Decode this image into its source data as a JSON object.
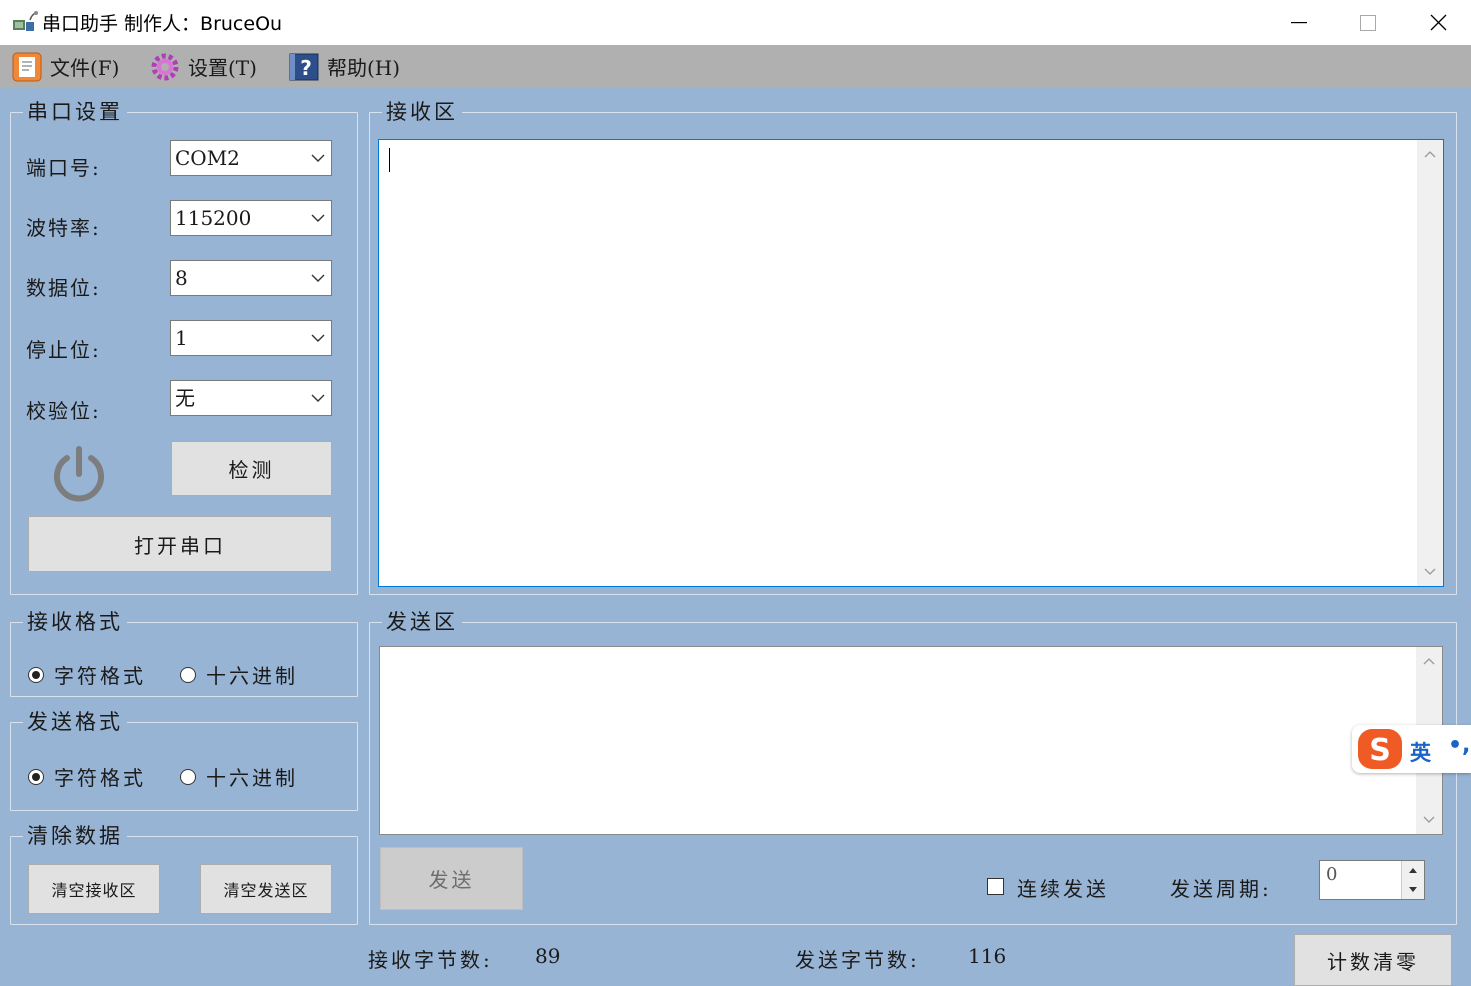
{
  "window": {
    "title": "串口助手 制作人：BruceOu"
  },
  "menu": {
    "file": "文件(F)",
    "settings": "设置(T)",
    "help": "帮助(H)"
  },
  "serial_settings": {
    "group_title": "串口设置",
    "port_label": "端口号:",
    "port_value": "COM2",
    "baud_label": "波特率:",
    "baud_value": "115200",
    "data_bits_label": "数据位:",
    "data_bits_value": "8",
    "stop_bits_label": "停止位:",
    "stop_bits_value": "1",
    "parity_label": "校验位:",
    "parity_value": "无",
    "detect_button": "检测",
    "open_button": "打开串口"
  },
  "receive_format": {
    "group_title": "接收格式",
    "option_text": "字符格式",
    "option_hex": "十六进制",
    "selected": "text"
  },
  "send_format": {
    "group_title": "发送格式",
    "option_text": "字符格式",
    "option_hex": "十六进制",
    "selected": "text"
  },
  "clear_data": {
    "group_title": "清除数据",
    "clear_receive": "清空接收区",
    "clear_send": "清空发送区"
  },
  "receive_area": {
    "group_title": "接收区",
    "content": ""
  },
  "send_area": {
    "group_title": "发送区",
    "content": "",
    "send_button": "发送",
    "continuous_label": "连续发送",
    "continuous_checked": false,
    "period_label": "发送周期:",
    "period_value": "0"
  },
  "status": {
    "rx_label": "接收字节数:",
    "rx_value": "89",
    "tx_label": "发送字节数:",
    "tx_value": "116",
    "reset_button": "计数清零"
  },
  "ime": {
    "logo": "S",
    "mode": "英",
    "punct": "•,"
  },
  "colors": {
    "background": "#98b4d4",
    "menubar": "#b0b0b0",
    "ime_orange": "#f05a24",
    "ime_blue": "#1a63c8"
  }
}
